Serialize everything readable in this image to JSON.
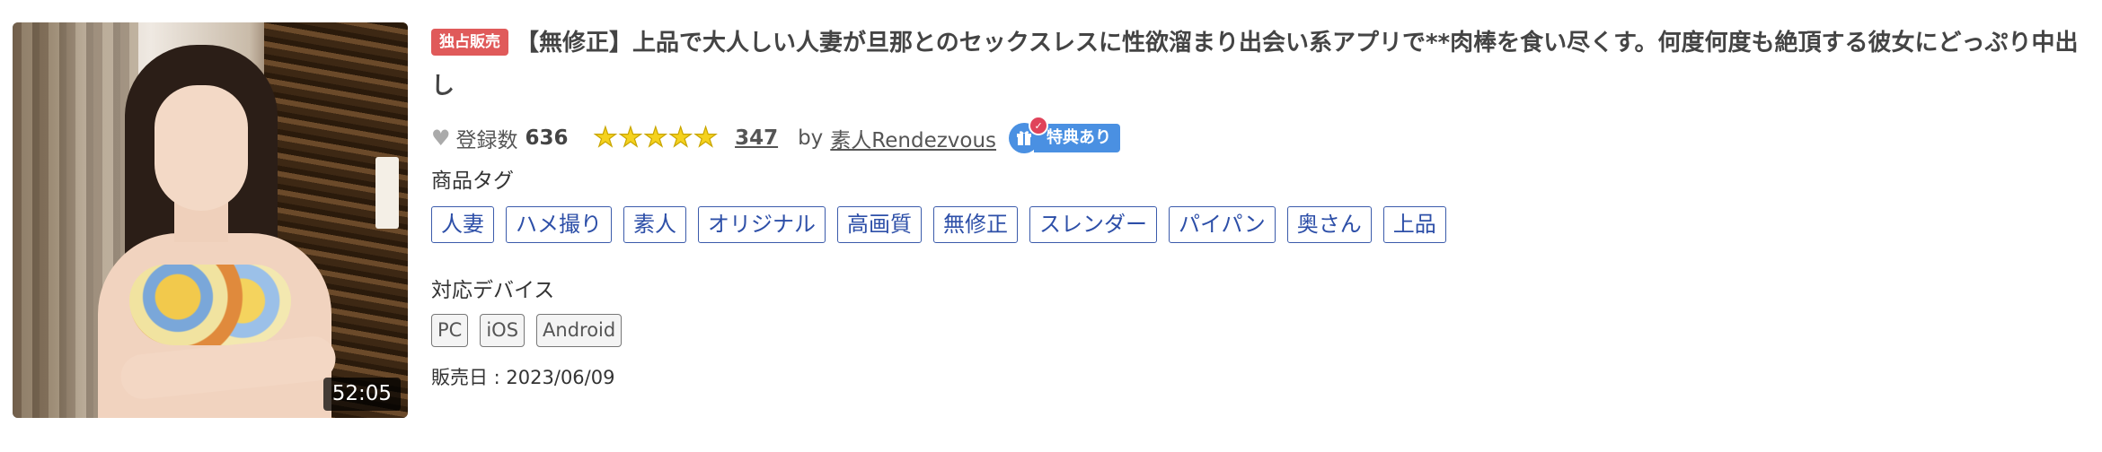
{
  "thumbnail": {
    "duration": "52:05"
  },
  "product": {
    "exclusive_badge": "独占販売",
    "title": "【無修正】上品で大人しい人妻が旦那とのセックスレスに性欲溜まり出会い系アプリで**肉棒を食い尽くす。何度何度も絶頂する彼女にどっぷり中出し"
  },
  "meta": {
    "registered_label": "登録数",
    "registered_count": "636",
    "rating_stars": 5,
    "review_count": "347",
    "by_label": "by",
    "seller": "素人Rendezvous",
    "bonus_icon_text": "",
    "bonus_label": "特典あり"
  },
  "tags": {
    "label": "商品タグ",
    "items": [
      "人妻",
      "ハメ撮り",
      "素人",
      "オリジナル",
      "高画質",
      "無修正",
      "スレンダー",
      "パイパン",
      "奥さん",
      "上品"
    ]
  },
  "devices": {
    "label": "対応デバイス",
    "items": [
      "PC",
      "iOS",
      "Android"
    ]
  },
  "release": {
    "text": "販売日 : 2023/06/09"
  },
  "colors": {
    "exclusive_badge": "#e05a5a",
    "tag_border": "#3b5bab",
    "star": "#f5d21e",
    "bonus": "#4a90e2"
  }
}
